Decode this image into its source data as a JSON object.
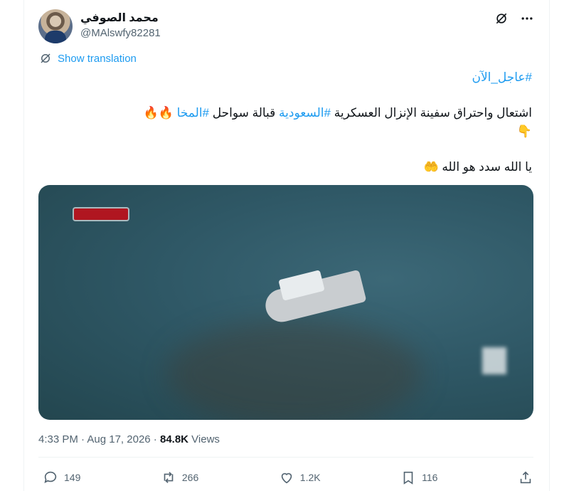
{
  "author": {
    "display_name": "محمد الصوفي",
    "handle": "@MAlswfy82281"
  },
  "translate_label": "Show translation",
  "tweet": {
    "line1_hashtag": "#عاجل_الآن",
    "line2_text_a": "اشتعال واحتراق  سفينة الإنزال العسكرية ",
    "line2_hashtag_a": "#السعودية",
    "line2_text_b": " قبالة سواحل ",
    "line2_hashtag_b": "#المخا",
    "line2_emoji": " 🔥🔥",
    "line2_pointer": "👇",
    "line3_text": "يا الله سدد هو الله 🤲"
  },
  "meta": {
    "time": "4:33 PM",
    "sep1": " · ",
    "date": "Aug 17, 2026",
    "sep2": " · ",
    "views_count": "84.8K",
    "views_label": " Views"
  },
  "actions": {
    "replies": "149",
    "reposts": "266",
    "likes": "1.2K",
    "bookmarks": "116"
  },
  "colors": {
    "accent": "#1d9bf0",
    "text": "#0f1419",
    "muted": "#536471"
  }
}
